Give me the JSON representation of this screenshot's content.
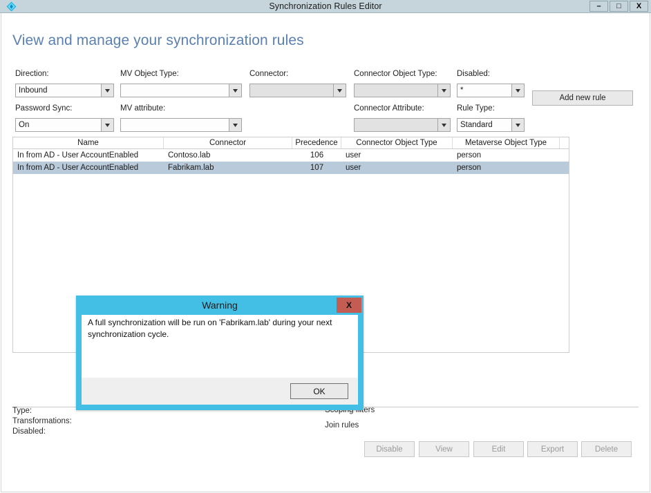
{
  "window": {
    "title": "Synchronization Rules Editor",
    "icon": "sync-diamond-icon",
    "controls": {
      "minimize": "–",
      "maximize": "□",
      "close": "X"
    },
    "titlebar_color": "#c6d5db"
  },
  "page": {
    "heading": "View and manage your synchronization rules",
    "heading_color": "#5a80b1"
  },
  "filters": {
    "direction": {
      "label": "Direction:",
      "value": "Inbound",
      "enabled": true
    },
    "password_sync": {
      "label": "Password Sync:",
      "value": "On",
      "enabled": true
    },
    "mv_object_type": {
      "label": "MV Object Type:",
      "value": "",
      "enabled": true
    },
    "mv_attribute": {
      "label": "MV attribute:",
      "value": "",
      "enabled": true
    },
    "connector": {
      "label": "Connector:",
      "value": "",
      "enabled": false
    },
    "connector_object_type": {
      "label": "Connector Object Type:",
      "value": "",
      "enabled": false
    },
    "connector_attribute": {
      "label": "Connector Attribute:",
      "value": "",
      "enabled": false
    },
    "disabled": {
      "label": "Disabled:",
      "value": "*",
      "enabled": true
    },
    "rule_type": {
      "label": "Rule Type:",
      "value": "Standard",
      "enabled": true
    },
    "add_new_rule": "Add new rule"
  },
  "grid": {
    "columns": [
      "Name",
      "Connector",
      "Precedence",
      "Connector Object Type",
      "Metaverse Object Type"
    ],
    "rows": [
      {
        "name": "In from AD - User AccountEnabled",
        "connector": "Contoso.lab",
        "precedence": "106",
        "connector_object_type": "user",
        "metaverse_object_type": "person",
        "selected": false
      },
      {
        "name": "In from AD - User AccountEnabled",
        "connector": "Fabrikam.lab",
        "precedence": "107",
        "connector_object_type": "user",
        "metaverse_object_type": "person",
        "selected": true
      }
    ],
    "selected_row_color": "#b9cada"
  },
  "details": {
    "type_label": "Type:",
    "type_value": "",
    "transformations_label": "Transformations:",
    "transformations_value": "",
    "disabled_label": "Disabled:",
    "disabled_value": "",
    "scoping_filters_label": "Scoping filters",
    "join_rules_label": "Join rules"
  },
  "actions": {
    "buttons": [
      {
        "label": "Disable",
        "enabled": false
      },
      {
        "label": "View",
        "enabled": false
      },
      {
        "label": "Edit",
        "enabled": false
      },
      {
        "label": "Export",
        "enabled": false
      },
      {
        "label": "Delete",
        "enabled": false
      }
    ]
  },
  "dialog": {
    "title": "Warning",
    "close_label": "X",
    "message": "A full synchronization will be run on 'Fabrikam.lab' during your next synchronization cycle.",
    "ok_label": "OK",
    "border_color": "#43bfe5",
    "close_color": "#c35c52"
  }
}
